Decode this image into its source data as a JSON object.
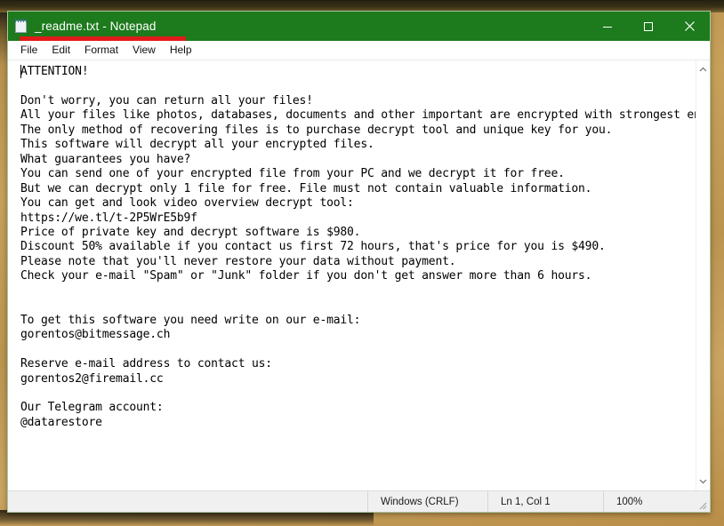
{
  "window": {
    "title": "_readme.txt - Notepad",
    "icon": "notepad-icon",
    "accent_color": "#1d7a1d",
    "highlight_bar_color": "#e01b1b",
    "controls": {
      "minimize": "Minimize",
      "maximize": "Maximize",
      "close": "Close"
    }
  },
  "menubar": {
    "items": [
      {
        "label": "File"
      },
      {
        "label": "Edit"
      },
      {
        "label": "Format"
      },
      {
        "label": "View"
      },
      {
        "label": "Help"
      }
    ]
  },
  "document": {
    "filename": "_readme.txt",
    "content": "ATTENTION!\n\nDon't worry, you can return all your files!\nAll your files like photos, databases, documents and other important are encrypted with strongest encryption and unique key.\nThe only method of recovering files is to purchase decrypt tool and unique key for you.\nThis software will decrypt all your encrypted files.\nWhat guarantees you have?\nYou can send one of your encrypted file from your PC and we decrypt it for free.\nBut we can decrypt only 1 file for free. File must not contain valuable information.\nYou can get and look video overview decrypt tool:\nhttps://we.tl/t-2P5WrE5b9f\nPrice of private key and decrypt software is $980.\nDiscount 50% available if you contact us first 72 hours, that's price for you is $490.\nPlease note that you'll never restore your data without payment.\nCheck your e-mail \"Spam\" or \"Junk\" folder if you don't get answer more than 6 hours.\n\n\nTo get this software you need write on our e-mail:\ngorentos@bitmessage.ch\n\nReserve e-mail address to contact us:\ngorentos2@firemail.cc\n\nOur Telegram account:\n@datarestore",
    "lines": [
      "ATTENTION!",
      "",
      "Don't worry, you can return all your files!",
      "All your files like photos, databases, documents and other important are encrypted with",
      "strongest encryption and unique key.",
      "The only method of recovering files is to purchase decrypt tool and unique key for you.",
      "This software will decrypt all your encrypted files.",
      "What guarantees you have?",
      "You can send one of your encrypted file from your PC and we decrypt it for free.",
      "But we can decrypt only 1 file for free. File must not contain valuable information.",
      "You can get and look video overview decrypt tool:",
      "https://we.tl/t-2P5WrE5b9f",
      "Price of private key and decrypt software is $980.",
      "Discount 50% available if you contact us first 72 hours, that's price for you is $490.",
      "Please note that you'll never restore your data without payment.",
      "Check your e-mail \"Spam\" or \"Junk\" folder if you don't get answer more than 6 hours.",
      "",
      "",
      "To get this software you need write on our e-mail:",
      "gorentos@bitmessage.ch",
      "",
      "Reserve e-mail address to contact us:",
      "gorentos2@firemail.cc",
      "",
      "Our Telegram account:",
      "@datarestore"
    ],
    "contacts": {
      "video_url": "https://we.tl/t-2P5WrE5b9f",
      "email_primary": "gorentos@bitmessage.ch",
      "email_reserve": "gorentos2@firemail.cc",
      "telegram": "@datarestore"
    },
    "amounts": {
      "price": "$980",
      "discount_price": "$490",
      "discount_percent": "50%",
      "discount_window": "72 hours",
      "answer_window": "6 hours",
      "free_files": "1 file"
    }
  },
  "scrollbar": {
    "up_arrow": "scroll-up-icon",
    "down_arrow": "scroll-down-icon"
  },
  "statusbar": {
    "encoding": "Windows (CRLF)",
    "position": "Ln 1, Col 1",
    "zoom": "100%"
  }
}
